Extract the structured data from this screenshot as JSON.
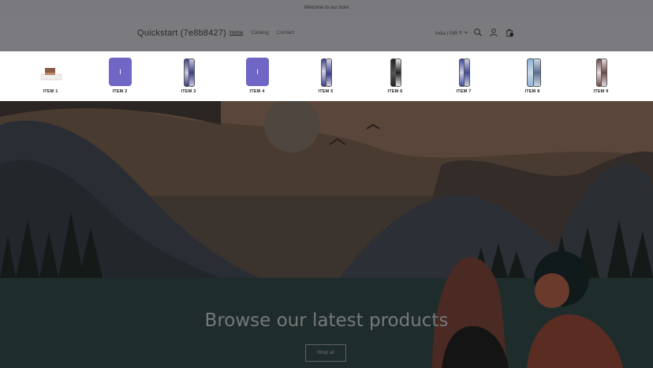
{
  "announcement": "Welcome to our store",
  "header": {
    "brand": "Quickstart (7e8b8427)",
    "nav": [
      "Home",
      "Catalog",
      "Contact"
    ],
    "locale": "India | INR ₹"
  },
  "products": [
    {
      "label": "ITEM 1",
      "kind": "photo"
    },
    {
      "label": "ITEM 2",
      "kind": "tile",
      "glyph": "I"
    },
    {
      "label": "ITEM 3",
      "kind": "board",
      "colors": [
        "#3d3f8a",
        "#c9c8e4"
      ]
    },
    {
      "label": "ITEM 4",
      "kind": "tile",
      "glyph": "I"
    },
    {
      "label": "ITEM 5",
      "kind": "board",
      "colors": [
        "#3b3f86",
        "#d5d4ea"
      ]
    },
    {
      "label": "ITEM 6",
      "kind": "board",
      "colors": [
        "#222222",
        "#e9e9e9"
      ]
    },
    {
      "label": "ITEM 7",
      "kind": "board",
      "colors": [
        "#3f4d98",
        "#d0d0e6"
      ]
    },
    {
      "label": "ITEM 8",
      "kind": "board",
      "colors": [
        "#8fb3d6",
        "#cdd8e6"
      ]
    },
    {
      "label": "ITEM 9",
      "kind": "board",
      "colors": [
        "#6b4b4a",
        "#e6dede"
      ]
    }
  ],
  "hero": {
    "title": "Browse our latest products",
    "button": "Shop all"
  },
  "colors": {
    "accent_tile": "#6f66c6",
    "overlay": "#7b7b7f"
  }
}
